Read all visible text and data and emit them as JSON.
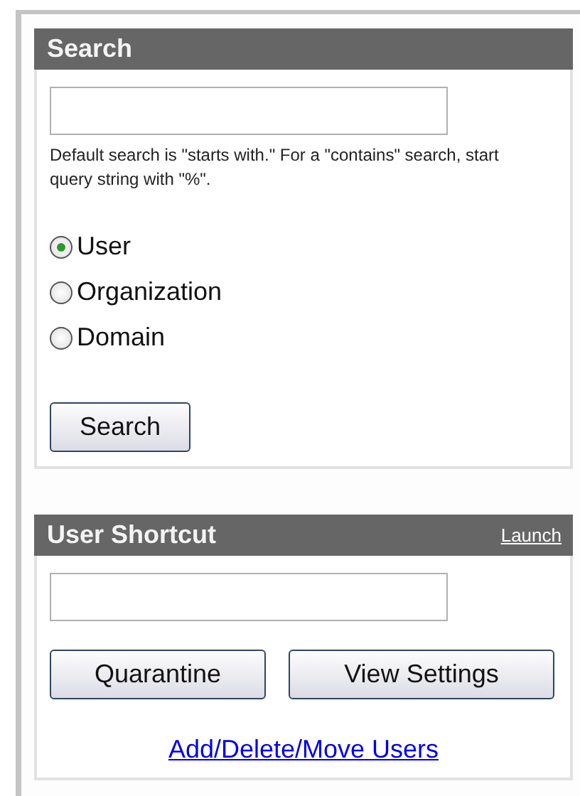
{
  "search_panel": {
    "title": "Search",
    "help_text": "Default search is \"starts with.\"  For a \"contains\" search, start query string with \"%\".",
    "options": [
      {
        "label": "User",
        "selected": true
      },
      {
        "label": "Organization",
        "selected": false
      },
      {
        "label": "Domain",
        "selected": false
      }
    ],
    "button": "Search"
  },
  "shortcut_panel": {
    "title": "User Shortcut",
    "header_link": "Launch",
    "buttons": [
      "Quarantine",
      "View Settings"
    ],
    "footer_link": "Add/Delete/Move Users"
  }
}
